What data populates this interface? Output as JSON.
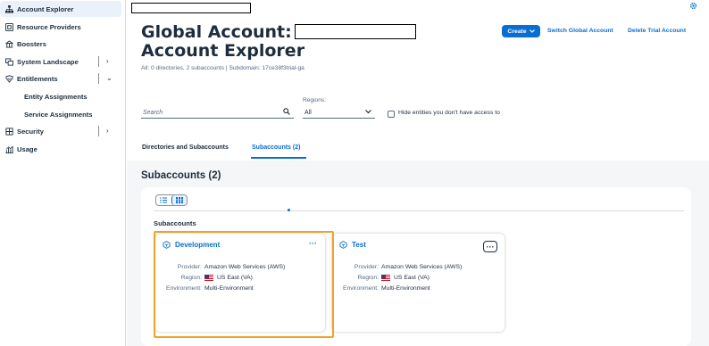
{
  "sidebar": {
    "items": [
      {
        "icon": "hierarchy-icon",
        "label": "Account Explorer",
        "selected": true
      },
      {
        "icon": "resource-providers-icon",
        "label": "Resource Providers"
      },
      {
        "icon": "boosters-icon",
        "label": "Boosters"
      },
      {
        "icon": "system-landscape-icon",
        "label": "System Landscape",
        "chevron": "›"
      },
      {
        "icon": "entitlements-icon",
        "label": "Entitlements",
        "chevron": "⌄"
      },
      {
        "label": "Entity Assignments",
        "sub": true
      },
      {
        "label": "Service Assignments",
        "sub": true
      },
      {
        "icon": "security-icon",
        "label": "Security",
        "chevron": "›"
      },
      {
        "icon": "usage-icon",
        "label": "Usage"
      }
    ]
  },
  "header": {
    "title_line1": "Global Account:",
    "title_line2": "Account Explorer",
    "subtitle": "All: 0 directories, 2 subaccounts | Subdomain: 17ce38f3trial-ga",
    "create_label": "Create",
    "switch_label": "Switch Global Account",
    "delete_label": "Delete Trial Account"
  },
  "filters": {
    "search_placeholder": "Search",
    "regions_label": "Regions:",
    "regions_value": "All",
    "hide_label": "Hide entities you don't have access to"
  },
  "tabs": [
    {
      "label": "Directories and Subaccounts",
      "active": false
    },
    {
      "label": "Subaccounts (2)",
      "active": true
    }
  ],
  "content": {
    "section_title": "Subaccounts (2)",
    "list_label": "Subaccounts",
    "cards": [
      {
        "name": "Development",
        "provider_key": "Provider:",
        "provider": "Amazon Web Services (AWS)",
        "region_key": "Region:",
        "region": "US East (VA)",
        "env_key": "Environment:",
        "environment": "Multi-Environment",
        "more": "···"
      },
      {
        "name": "Test",
        "provider_key": "Provider:",
        "provider": "Amazon Web Services (AWS)",
        "region_key": "Region:",
        "region": "US East (VA)",
        "env_key": "Environment:",
        "environment": "Multi-Environment",
        "more": "···"
      }
    ]
  },
  "colors": {
    "accent": "#0a6ed1",
    "highlight": "#f0a328",
    "text": "#1d2d3e"
  }
}
